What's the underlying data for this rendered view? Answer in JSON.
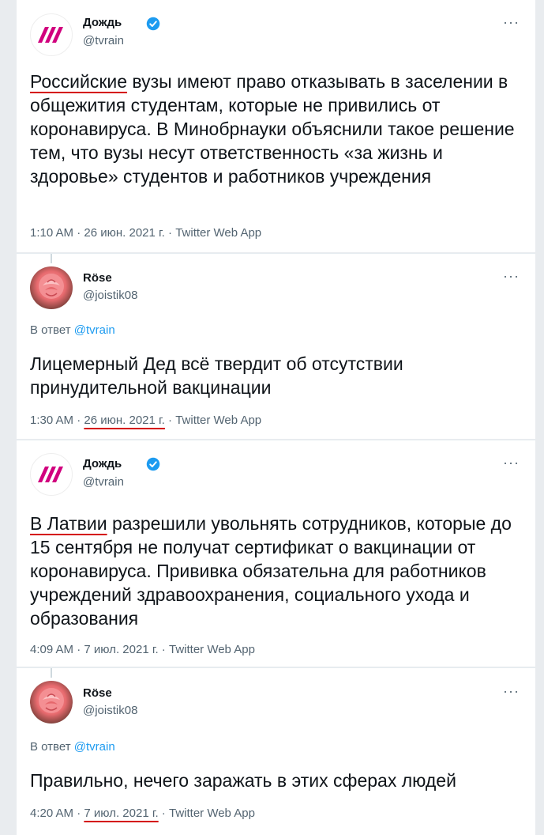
{
  "tweets": [
    {
      "name": "Дождь",
      "handle": "@tvrain",
      "more": "···",
      "text_highlight": "Российские",
      "text_rest": " вузы имеют право отказывать в заселении в общежития студентам, которые не привились от коронавируса. В Минобрнауки объяснили такое решение тем, что вузы несут ответственность «за жизнь и здоровье» студентов и работников учреждения",
      "time": "1:10 AM",
      "dot1": " · ",
      "date": "26 июн. 2021 г.",
      "dot2": " · ",
      "source": "Twitter Web App"
    },
    {
      "name": "Röse",
      "handle": "@joistik08",
      "more": "···",
      "reply_prefix": "В ответ ",
      "reply_mention": "@tvrain",
      "text": "Лицемерный Дед всё твердит об отсутствии принудительной вакцинации",
      "time": "1:30 AM",
      "dot1": " · ",
      "date": "26 июн. 2021 г.",
      "dot2": " · ",
      "source": "Twitter Web App"
    },
    {
      "name": "Дождь",
      "handle": "@tvrain",
      "more": "···",
      "text_highlight": "В Латвии",
      "text_rest": " разрешили увольнять сотрудников, которые до 15 сентября не получат сертификат о вакцинации от коронавируса. Прививка обязательна для работников учреждений здравоохранения, социального ухода и образования",
      "time": "4:09 AM",
      "dot1": " · ",
      "date": "7 июл. 2021 г.",
      "dot2": " · ",
      "source": "Twitter Web App"
    },
    {
      "name": "Röse",
      "handle": "@joistik08",
      "more": "···",
      "reply_prefix": "В ответ ",
      "reply_mention": "@tvrain",
      "text": "Правильно, нечего заражать в этих сферах людей",
      "time": "4:20 AM",
      "dot1": " · ",
      "date": "7 июл. 2021 г.",
      "dot2": " · ",
      "source": "Twitter Web App"
    }
  ],
  "colors": {
    "accent": "#1d9bf0",
    "verified": "#1d9bf0",
    "underline": "#d40000",
    "tvrain_logo": "#d1007e",
    "secondary_text": "#536471"
  },
  "icons": {
    "verified": "verified-badge-icon",
    "more": "more-options-icon",
    "tvrain_logo": "tvrain-logo",
    "rose_avatar": "rose-avatar"
  }
}
